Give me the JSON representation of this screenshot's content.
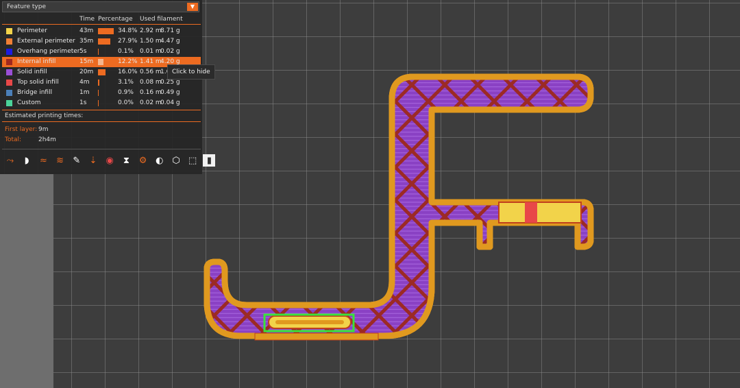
{
  "feature_selector": {
    "label": "Feature type",
    "arrow": "▼"
  },
  "columns": {
    "time": "Time",
    "percentage": "Percentage",
    "filament": "Used filament"
  },
  "features": [
    {
      "name": "Perimeter",
      "time": "43m",
      "pct": "34.8%",
      "pct_value": 34.8,
      "len": "2.92 m",
      "weight": "8.71 g",
      "color": "#f2d34a"
    },
    {
      "name": "External perimeter",
      "time": "35m",
      "pct": "27.9%",
      "pct_value": 27.9,
      "len": "1.50 m",
      "weight": "4.47 g",
      "color": "#f07f35"
    },
    {
      "name": "Overhang perimeter",
      "time": "5s",
      "pct": "0.1%",
      "pct_value": 0.1,
      "len": "0.01 m",
      "weight": "0.02 g",
      "color": "#1c1ce0"
    },
    {
      "name": "Internal infill",
      "time": "15m",
      "pct": "12.2%",
      "pct_value": 12.2,
      "len": "1.41 m",
      "weight": "4.20 g",
      "color": "#a0281e",
      "highlighted": true
    },
    {
      "name": "Solid infill",
      "time": "20m",
      "pct": "16.0%",
      "pct_value": 16.0,
      "len": "0.56 m",
      "weight": "1.67 g",
      "color": "#9a4fd6"
    },
    {
      "name": "Top solid infill",
      "time": "4m",
      "pct": "3.1%",
      "pct_value": 3.1,
      "len": "0.08 m",
      "weight": "0.25 g",
      "color": "#e84848"
    },
    {
      "name": "Bridge infill",
      "time": "1m",
      "pct": "0.9%",
      "pct_value": 0.9,
      "len": "0.16 m",
      "weight": "0.49 g",
      "color": "#4b7fb8"
    },
    {
      "name": "Custom",
      "time": "1s",
      "pct": "0.0%",
      "pct_value": 0.0,
      "len": "0.02 m",
      "weight": "0.04 g",
      "color": "#4ad49a"
    }
  ],
  "estimates": {
    "title": "Estimated printing times:",
    "first_layer_label": "First layer:",
    "first_layer": "9m",
    "total_label": "Total:",
    "total": "2h4m"
  },
  "tooltip": "Click to hide",
  "toolbar_icons": [
    "travel-icon",
    "wipe-icon",
    "retractions-icon",
    "deretractions-icon",
    "seams-icon",
    "tool-changes-icon",
    "color-changes-icon",
    "pause-print-icon",
    "custom-gcode-icon",
    "center-of-gravity-icon",
    "shells-icon",
    "bounding-box-icon",
    "legend-icon"
  ],
  "colors": {
    "accent": "#ed6b21",
    "background": "#3d3d3d",
    "selection": "#39e339"
  }
}
